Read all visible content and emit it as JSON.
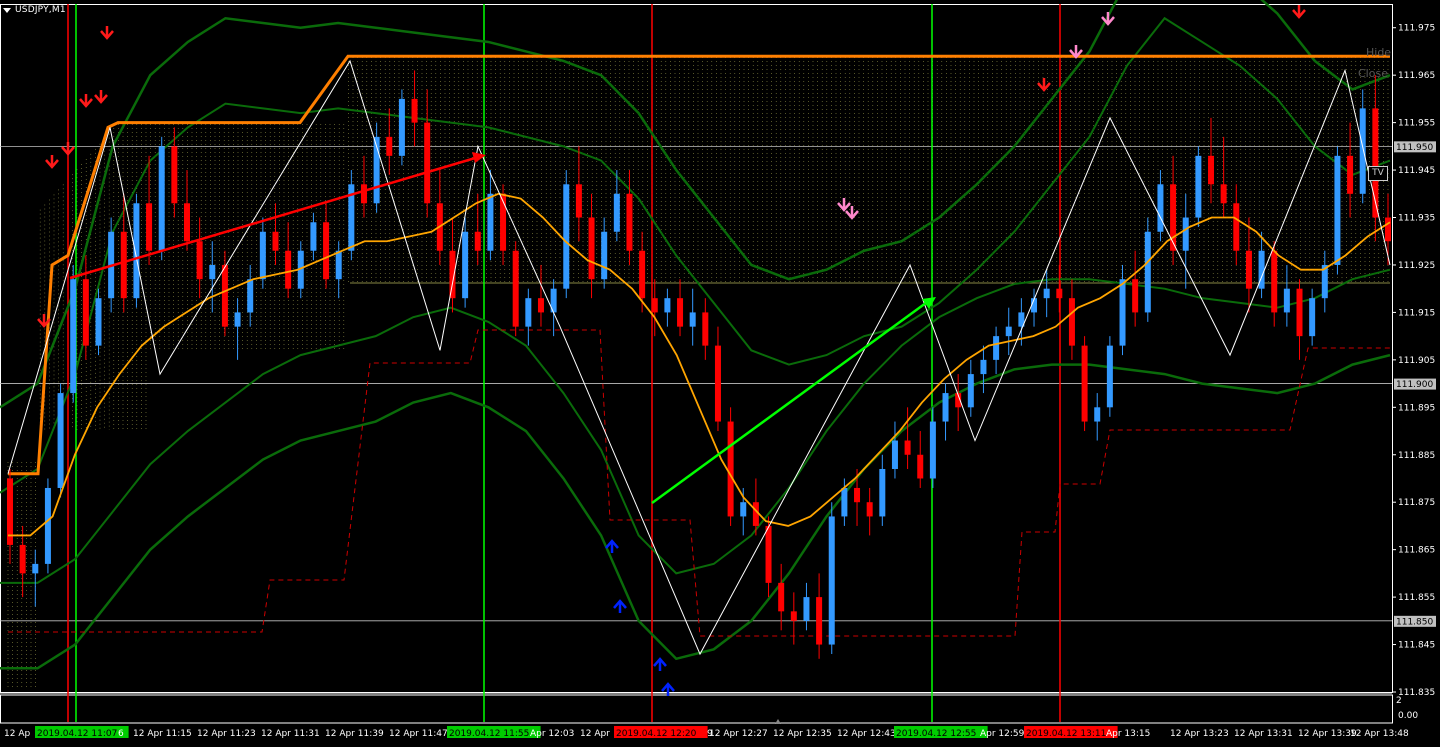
{
  "window": {
    "symbol_label": "USDJPY,M1"
  },
  "buttons": {
    "hide": "Hide",
    "close": "Close",
    "tv": "TV"
  },
  "colors": {
    "background": "#000000",
    "bull": "#3399ff",
    "bear": "#ff0000",
    "ma": "#ffa500",
    "band": "#0a6b0a",
    "green_line": "#00ff00",
    "red_line": "#ff0000",
    "zigzag": "#ffffff",
    "cloud_grid": "#b5b55a",
    "arrow_down": "#ff1a1a",
    "arrow_down_pink": "#ff88cc",
    "arrow_up": "#0022ff",
    "orange_level": "#ff7f00",
    "dashed_red": "#cc0000"
  },
  "chart_data": {
    "type": "candlestick",
    "symbol": "USDJPY",
    "timeframe": "M1",
    "ylim": [
      111.835,
      111.98
    ],
    "y_ticks": [
      "111.975",
      "111.965",
      "111.955",
      "111.945",
      "111.935",
      "111.925",
      "111.915",
      "111.905",
      "111.895",
      "111.885",
      "111.875",
      "111.865",
      "111.855",
      "111.845",
      "111.835"
    ],
    "price_lines": [
      {
        "value": 111.95,
        "label": "111.950"
      },
      {
        "value": 111.9,
        "label": "111.900"
      },
      {
        "value": 111.85,
        "label": "111.850"
      }
    ],
    "x_labels": [
      "12 Ap",
      "2019.04.12 11:07",
      "6",
      "12 Apr 11:15",
      "12 Apr 11:23",
      "12 Apr 11:31",
      "12 Apr 11:39",
      "12 Apr 11:47",
      "2019.04.12 11:55",
      "Apr 12:03",
      "12 Apr",
      "2019.04.12 12:20",
      "9",
      "12 Apr 12:27",
      "12 Apr 12:35",
      "12 Apr 12:43",
      "2019.04.12 12:55",
      "Apr 12:59",
      "2019.04.12 13:11",
      "Apr 13:15",
      "12 Apr 13:23",
      "12 Apr 13:31",
      "12 Apr 13:39",
      "12 Apr 13:48"
    ],
    "sub_scale": [
      "2",
      "0.00"
    ],
    "ohlc": [
      [
        111.88,
        111.882,
        111.862,
        111.866
      ],
      [
        111.866,
        111.87,
        111.855,
        111.86
      ],
      [
        111.86,
        111.865,
        111.853,
        111.862
      ],
      [
        111.862,
        111.88,
        111.86,
        111.878
      ],
      [
        111.878,
        111.9,
        111.876,
        111.898
      ],
      [
        111.898,
        111.925,
        111.896,
        111.922
      ],
      [
        111.922,
        111.927,
        111.905,
        111.908
      ],
      [
        111.908,
        111.92,
        111.906,
        111.918
      ],
      [
        111.918,
        111.935,
        111.915,
        111.932
      ],
      [
        111.932,
        111.94,
        111.915,
        111.918
      ],
      [
        111.918,
        111.94,
        111.916,
        111.938
      ],
      [
        111.938,
        111.948,
        111.925,
        111.928
      ],
      [
        111.928,
        111.952,
        111.926,
        111.95
      ],
      [
        111.95,
        111.954,
        111.935,
        111.938
      ],
      [
        111.938,
        111.945,
        111.928,
        111.93
      ],
      [
        111.93,
        111.935,
        111.918,
        111.922
      ],
      [
        111.922,
        111.93,
        111.915,
        111.925
      ],
      [
        111.925,
        111.928,
        111.91,
        111.912
      ],
      [
        111.912,
        111.918,
        111.905,
        111.915
      ],
      [
        111.915,
        111.925,
        111.912,
        111.922
      ],
      [
        111.922,
        111.935,
        111.92,
        111.932
      ],
      [
        111.932,
        111.938,
        111.925,
        111.928
      ],
      [
        111.928,
        111.934,
        111.918,
        111.92
      ],
      [
        111.92,
        111.93,
        111.918,
        111.928
      ],
      [
        111.928,
        111.936,
        111.926,
        111.934
      ],
      [
        111.934,
        111.938,
        111.92,
        111.922
      ],
      [
        111.922,
        111.93,
        111.918,
        111.928
      ],
      [
        111.928,
        111.945,
        111.926,
        111.942
      ],
      [
        111.942,
        111.948,
        111.935,
        111.938
      ],
      [
        111.938,
        111.955,
        111.936,
        111.952
      ],
      [
        111.952,
        111.958,
        111.944,
        111.948
      ],
      [
        111.948,
        111.962,
        111.946,
        111.96
      ],
      [
        111.96,
        111.966,
        111.95,
        111.955
      ],
      [
        111.955,
        111.962,
        111.935,
        111.938
      ],
      [
        111.938,
        111.945,
        111.925,
        111.928
      ],
      [
        111.928,
        111.935,
        111.915,
        111.918
      ],
      [
        111.918,
        111.935,
        111.916,
        111.932
      ],
      [
        111.932,
        111.94,
        111.925,
        111.928
      ],
      [
        111.928,
        111.945,
        111.926,
        111.94
      ],
      [
        111.94,
        111.942,
        111.925,
        111.928
      ],
      [
        111.928,
        111.93,
        111.91,
        111.912
      ],
      [
        111.912,
        111.92,
        111.908,
        111.918
      ],
      [
        111.918,
        111.925,
        111.912,
        111.915
      ],
      [
        111.915,
        111.922,
        111.91,
        111.92
      ],
      [
        111.92,
        111.945,
        111.918,
        111.942
      ],
      [
        111.942,
        111.95,
        111.93,
        111.935
      ],
      [
        111.935,
        111.94,
        111.918,
        111.922
      ],
      [
        111.922,
        111.935,
        111.92,
        111.932
      ],
      [
        111.932,
        111.945,
        111.93,
        111.94
      ],
      [
        111.94,
        111.945,
        111.925,
        111.928
      ],
      [
        111.928,
        111.932,
        111.915,
        111.918
      ],
      [
        111.918,
        111.922,
        111.91,
        111.915
      ],
      [
        111.915,
        111.92,
        111.912,
        111.918
      ],
      [
        111.918,
        111.922,
        111.91,
        111.912
      ],
      [
        111.912,
        111.92,
        111.908,
        111.915
      ],
      [
        111.915,
        111.918,
        111.905,
        111.908
      ],
      [
        111.908,
        111.912,
        111.89,
        111.892
      ],
      [
        111.892,
        111.895,
        111.87,
        111.872
      ],
      [
        111.872,
        111.878,
        111.868,
        111.875
      ],
      [
        111.875,
        111.88,
        111.868,
        111.87
      ],
      [
        111.87,
        111.872,
        111.855,
        111.858
      ],
      [
        111.858,
        111.862,
        111.848,
        111.852
      ],
      [
        111.852,
        111.856,
        111.845,
        111.85
      ],
      [
        111.85,
        111.858,
        111.848,
        111.855
      ],
      [
        111.855,
        111.86,
        111.842,
        111.845
      ],
      [
        111.845,
        111.875,
        111.843,
        111.872
      ],
      [
        111.872,
        111.88,
        111.87,
        111.878
      ],
      [
        111.878,
        111.882,
        111.87,
        111.875
      ],
      [
        111.875,
        111.878,
        111.868,
        111.872
      ],
      [
        111.872,
        111.885,
        111.87,
        111.882
      ],
      [
        111.882,
        111.892,
        111.88,
        111.888
      ],
      [
        111.888,
        111.895,
        111.882,
        111.885
      ],
      [
        111.885,
        111.89,
        111.878,
        111.88
      ],
      [
        111.88,
        111.895,
        111.878,
        111.892
      ],
      [
        111.892,
        111.9,
        111.888,
        111.898
      ],
      [
        111.898,
        111.902,
        111.89,
        111.895
      ],
      [
        111.895,
        111.905,
        111.893,
        111.902
      ],
      [
        111.902,
        111.908,
        111.898,
        111.905
      ],
      [
        111.905,
        111.912,
        111.902,
        111.91
      ],
      [
        111.91,
        111.916,
        111.906,
        111.912
      ],
      [
        111.912,
        111.918,
        111.908,
        111.915
      ],
      [
        111.915,
        111.92,
        111.912,
        111.918
      ],
      [
        111.918,
        111.924,
        111.914,
        111.92
      ],
      [
        111.92,
        111.925,
        111.915,
        111.918
      ],
      [
        111.918,
        111.922,
        111.905,
        111.908
      ],
      [
        111.908,
        111.91,
        111.89,
        111.892
      ],
      [
        111.892,
        111.898,
        111.888,
        111.895
      ],
      [
        111.895,
        111.91,
        111.893,
        111.908
      ],
      [
        111.908,
        111.925,
        111.906,
        111.922
      ],
      [
        111.922,
        111.928,
        111.912,
        111.915
      ],
      [
        111.915,
        111.935,
        111.913,
        111.932
      ],
      [
        111.932,
        111.945,
        111.93,
        111.942
      ],
      [
        111.942,
        111.948,
        111.925,
        111.928
      ],
      [
        111.928,
        111.94,
        111.92,
        111.935
      ],
      [
        111.935,
        111.95,
        111.933,
        111.948
      ],
      [
        111.948,
        111.956,
        111.938,
        111.942
      ],
      [
        111.942,
        111.952,
        111.935,
        111.938
      ],
      [
        111.938,
        111.942,
        111.925,
        111.928
      ],
      [
        111.928,
        111.935,
        111.915,
        111.92
      ],
      [
        111.92,
        111.932,
        111.918,
        111.928
      ],
      [
        111.928,
        111.93,
        111.912,
        111.915
      ],
      [
        111.915,
        111.925,
        111.912,
        111.92
      ],
      [
        111.92,
        111.922,
        111.905,
        111.91
      ],
      [
        111.91,
        111.92,
        111.908,
        111.918
      ],
      [
        111.918,
        111.928,
        111.915,
        111.925
      ],
      [
        111.925,
        111.95,
        111.923,
        111.948
      ],
      [
        111.948,
        111.955,
        111.935,
        111.94
      ],
      [
        111.94,
        111.962,
        111.938,
        111.958
      ],
      [
        111.958,
        111.965,
        111.93,
        111.935
      ],
      [
        111.935,
        111.94,
        111.925,
        111.93
      ]
    ],
    "ma": [
      111.868,
      111.868,
      111.872,
      111.885,
      111.895,
      111.902,
      111.908,
      111.912,
      111.915,
      111.918,
      111.92,
      111.922,
      111.923,
      111.924,
      111.926,
      111.928,
      111.93,
      111.93,
      111.931,
      111.932,
      111.935,
      111.938,
      111.94,
      111.939,
      111.935,
      111.93,
      111.926,
      111.924,
      111.92,
      111.914,
      111.906,
      111.895,
      111.884,
      111.876,
      111.871,
      111.87,
      111.872,
      111.876,
      111.88,
      111.885,
      111.89,
      111.896,
      111.901,
      111.905,
      111.908,
      111.909,
      111.91,
      111.912,
      111.916,
      111.918,
      111.921,
      111.925,
      111.93,
      111.933,
      111.935,
      111.935,
      111.932,
      111.927,
      111.924,
      111.924,
      111.927,
      111.931,
      111.934
    ],
    "upper_band": [
      111.895,
      111.9,
      111.92,
      111.95,
      111.965,
      111.972,
      111.977,
      111.976,
      111.975,
      111.976,
      111.975,
      111.974,
      111.973,
      111.972,
      111.97,
      111.968,
      111.965,
      111.957,
      111.945,
      111.935,
      111.925,
      111.922,
      111.924,
      111.928,
      111.93,
      111.935,
      111.942,
      111.95,
      111.96,
      111.97,
      111.985,
      111.995,
      111.99,
      111.985,
      111.978,
      111.968,
      111.962,
      111.965
    ],
    "lower_band": [
      111.84,
      111.84,
      111.845,
      111.855,
      111.865,
      111.872,
      111.878,
      111.884,
      111.888,
      111.89,
      111.892,
      111.896,
      111.898,
      111.895,
      111.89,
      111.88,
      111.868,
      111.85,
      111.842,
      111.844,
      111.85,
      111.86,
      111.872,
      111.882,
      111.89,
      111.896,
      111.9,
      111.903,
      111.904,
      111.904,
      111.903,
      111.902,
      111.9,
      111.899,
      111.898,
      111.9,
      111.904,
      111.906
    ],
    "zigzag": [
      [
        111.89,
        111.88
      ],
      [
        111.924,
        111.95
      ],
      [
        111.905,
        111.968
      ],
      [
        111.908,
        111.95
      ],
      [
        111.912,
        111.843
      ],
      [
        111.925,
        111.888
      ],
      [
        111.956,
        111.906
      ],
      [
        111.966,
        111.925
      ]
    ]
  }
}
